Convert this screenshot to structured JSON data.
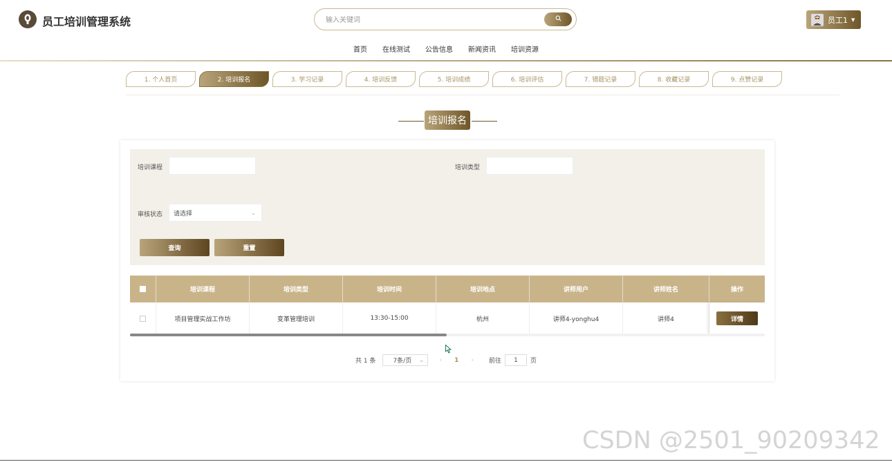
{
  "header": {
    "app_title": "员工培训管理系统",
    "search_placeholder": "输入关键词",
    "user_name": "员工1",
    "nav": [
      "首页",
      "在线测试",
      "公告信息",
      "新闻资讯",
      "培训资源"
    ]
  },
  "tabs": [
    "1. 个人首页",
    "2. 培训报名",
    "3. 学习记录",
    "4. 培训反馈",
    "5. 培训成绩",
    "6. 培训评估",
    "7. 错题记录",
    "8. 收藏记录",
    "9. 点赞记录"
  ],
  "active_tab_index": 1,
  "section_title": "培训报名",
  "filters": {
    "course_label": "培训课程",
    "type_label": "培训类型",
    "status_label": "审核状态",
    "status_placeholder": "请选择",
    "query_btn": "查询",
    "reset_btn": "重置"
  },
  "table": {
    "columns": [
      "培训课程",
      "培训类型",
      "培训时间",
      "培训地点",
      "讲师用户",
      "讲师姓名",
      "操作"
    ],
    "rows": [
      {
        "course": "项目管理实战工作坊",
        "type": "变革管理培训",
        "time": "13:30-15:00",
        "place": "杭州",
        "lecturer_user": "讲师4-yonghu4",
        "lecturer_name": "讲师4",
        "action": "详情"
      }
    ]
  },
  "pagination": {
    "total": "共 1 条",
    "page_size": "7条/页",
    "current": "1",
    "goto_label": "前往",
    "goto_value": "1",
    "page_suffix": "页"
  },
  "watermark": "CSDN @2501_90209342",
  "colors": {
    "accent_light": "#b9a47a",
    "accent_dark": "#6e5628",
    "filter_bg": "#f2f0e9",
    "table_head": "#c9b48a"
  }
}
